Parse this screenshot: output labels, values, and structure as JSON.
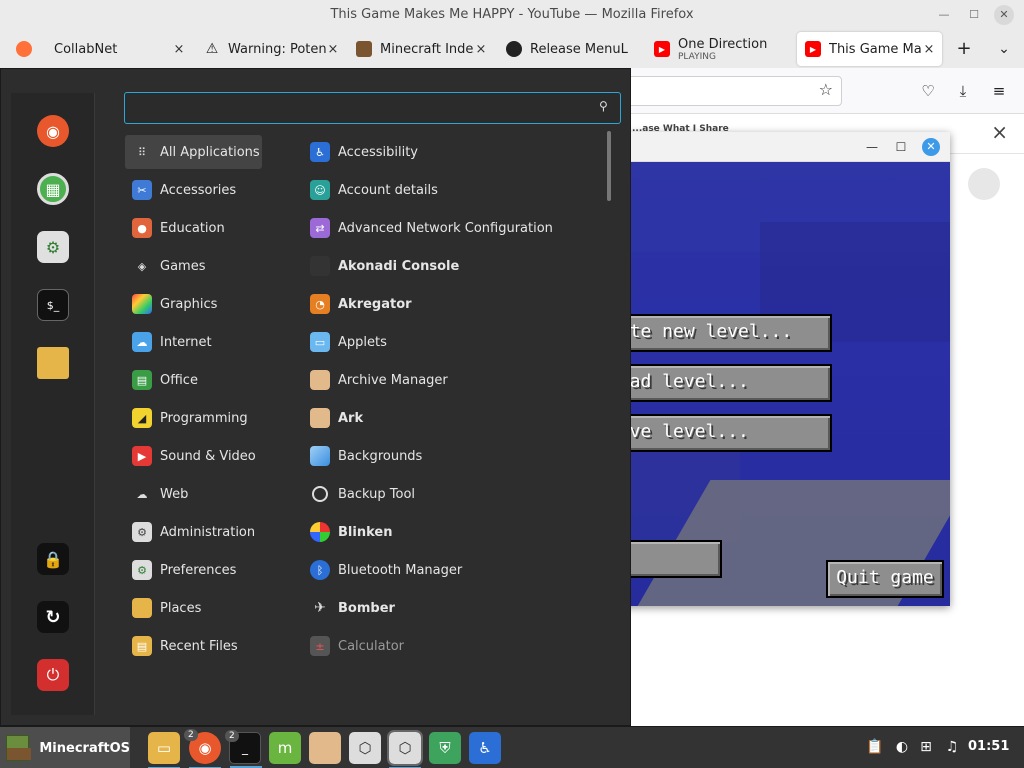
{
  "window": {
    "title": "This Game Makes Me HAPPY - YouTube — Mozilla Firefox",
    "minimize_icon": "minimize-icon",
    "maximize_icon": "maximize-icon",
    "close_icon": "close-icon"
  },
  "tabs": [
    {
      "label": "CollabNet",
      "icon": "firefox-icon",
      "close": "×"
    },
    {
      "label": "Warning: Potenti",
      "icon": "warning-icon",
      "close": "×"
    },
    {
      "label": "Minecraft Index",
      "icon": "minecraft-icon",
      "close": "×"
    },
    {
      "label": "Release MenuL",
      "icon": "github-icon",
      "close": "×"
    },
    {
      "label": "One Direction",
      "sub": "PLAYING",
      "icon": "youtube-icon"
    },
    {
      "label": "This Game Mak",
      "icon": "youtube-icon",
      "close": "×",
      "active": true
    }
  ],
  "tabbar": {
    "new_tab": "+",
    "list_all": "⌄"
  },
  "notification": {
    "text": "...ase What I Share",
    "close": "×"
  },
  "minecraft": {
    "buttons": {
      "create": "rate new level...",
      "load": "Load level...",
      "save": "Save level...",
      "quit": "Quit game"
    }
  },
  "menu": {
    "search": {
      "value": "",
      "placeholder": ""
    },
    "favorites": [
      "firefox-icon",
      "software-manager-icon",
      "settings-icon",
      "terminal-icon",
      "folder-icon"
    ],
    "session": [
      "lock-icon",
      "logout-icon",
      "power-icon"
    ],
    "categories": [
      {
        "label": "All Applications",
        "icon": "grid-icon",
        "selected": true
      },
      {
        "label": "Accessories",
        "icon": "scissors-icon"
      },
      {
        "label": "Education",
        "icon": "education-icon"
      },
      {
        "label": "Games",
        "icon": "gamepad-icon"
      },
      {
        "label": "Graphics",
        "icon": "graphics-icon"
      },
      {
        "label": "Internet",
        "icon": "cloud-icon"
      },
      {
        "label": "Office",
        "icon": "office-icon"
      },
      {
        "label": "Programming",
        "icon": "programming-icon"
      },
      {
        "label": "Sound & Video",
        "icon": "play-icon"
      },
      {
        "label": "Web",
        "icon": "web-icon"
      },
      {
        "label": "Administration",
        "icon": "admin-icon"
      },
      {
        "label": "Preferences",
        "icon": "preferences-icon"
      },
      {
        "label": "Places",
        "icon": "folder-icon"
      },
      {
        "label": "Recent Files",
        "icon": "recent-icon"
      }
    ],
    "apps": [
      {
        "label": "Accessibility",
        "icon": "accessibility-icon"
      },
      {
        "label": "Account details",
        "icon": "account-icon"
      },
      {
        "label": "Advanced Network Configuration",
        "icon": "network-icon"
      },
      {
        "label": "Akonadi Console",
        "icon": "akonadi-icon",
        "bold": true
      },
      {
        "label": "Akregator",
        "icon": "rss-icon",
        "bold": true
      },
      {
        "label": "Applets",
        "icon": "applets-icon"
      },
      {
        "label": "Archive Manager",
        "icon": "archive-icon"
      },
      {
        "label": "Ark",
        "icon": "archive-icon",
        "bold": true
      },
      {
        "label": "Backgrounds",
        "icon": "backgrounds-icon"
      },
      {
        "label": "Backup Tool",
        "icon": "backup-icon"
      },
      {
        "label": "Blinken",
        "icon": "blinken-icon",
        "bold": true
      },
      {
        "label": "Bluetooth Manager",
        "icon": "bluetooth-icon"
      },
      {
        "label": "Bomber",
        "icon": "plane-icon",
        "bold": true
      },
      {
        "label": "Calculator",
        "icon": "calculator-icon",
        "dim": true
      }
    ]
  },
  "taskbar": {
    "menu_label": "MinecraftOS",
    "apps": [
      {
        "name": "files",
        "icon": "folder-icon"
      },
      {
        "name": "firefox",
        "icon": "firefox-icon",
        "badge": "2"
      },
      {
        "name": "terminal",
        "icon": "terminal-icon",
        "badge": "2"
      },
      {
        "name": "mint",
        "icon": "mint-icon"
      },
      {
        "name": "archive",
        "icon": "archive-icon"
      },
      {
        "name": "minecraft",
        "icon": "cube-icon"
      },
      {
        "name": "minecraft-active",
        "icon": "cube-icon"
      },
      {
        "name": "shield",
        "icon": "shield-icon"
      },
      {
        "name": "accessibility",
        "icon": "accessibility-icon"
      }
    ],
    "tray": [
      "clipboard-icon",
      "chat-icon",
      "network-icon",
      "sound-icon"
    ],
    "clock": "01:51"
  }
}
